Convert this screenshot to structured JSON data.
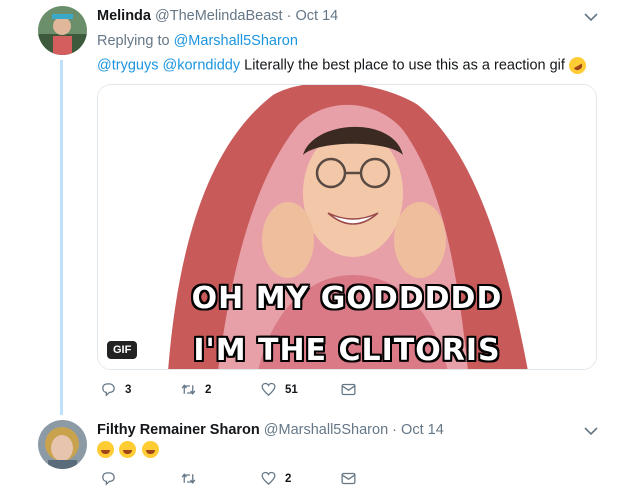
{
  "tweet1": {
    "name": "Melinda",
    "handle": "@TheMelindaBeast",
    "separator": "·",
    "date": "Oct 14",
    "replying_label": "Replying to",
    "replying_to": "@Marshall5Sharon",
    "mention1": "@tryguys",
    "mention2": "@korndiddy",
    "text": "Literally the best place to use this as a reaction gif",
    "media": {
      "badge": "GIF",
      "caption_line1": "OH MY GODDDDD",
      "caption_line2": "I'M THE CLITORIS"
    },
    "actions": {
      "replies": "3",
      "retweets": "2",
      "likes": "51"
    }
  },
  "tweet2": {
    "name": "Filthy Remainer Sharon",
    "handle": "@Marshall5Sharon",
    "separator": "·",
    "date": "Oct 14",
    "actions": {
      "replies": "",
      "retweets": "",
      "likes": "2"
    }
  },
  "colors": {
    "link": "#1b95e0",
    "thread_line": "#bfe0fb",
    "muted": "#657786"
  }
}
